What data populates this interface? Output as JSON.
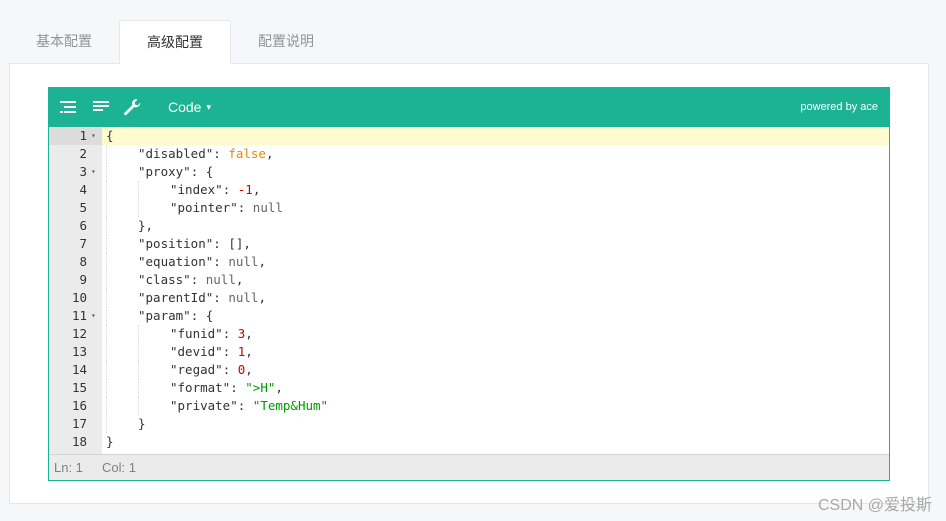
{
  "tabs": [
    {
      "label": "基本配置",
      "active": false
    },
    {
      "label": "高级配置",
      "active": true
    },
    {
      "label": "配置说明",
      "active": false
    }
  ],
  "editor": {
    "menu": {
      "icons": [
        "format-icon",
        "compact-icon",
        "repair-icon"
      ],
      "mode_label": "Code",
      "mode_caret": "▾",
      "powered_label": "powered by ace",
      "background_color": "#1bb394"
    },
    "lines": [
      {
        "n": "1",
        "fold": "▾",
        "indent": 0,
        "tokens": [
          {
            "t": "{",
            "c": "k"
          }
        ]
      },
      {
        "n": "2",
        "fold": "",
        "indent": 1,
        "tokens": [
          {
            "t": "\"disabled\"",
            "c": "k"
          },
          {
            "t": ": ",
            "c": "k"
          },
          {
            "t": "false",
            "c": "b"
          },
          {
            "t": ",",
            "c": "k"
          }
        ]
      },
      {
        "n": "3",
        "fold": "▾",
        "indent": 1,
        "tokens": [
          {
            "t": "\"proxy\"",
            "c": "k"
          },
          {
            "t": ": {",
            "c": "k"
          }
        ]
      },
      {
        "n": "4",
        "fold": "",
        "indent": 2,
        "tokens": [
          {
            "t": "\"index\"",
            "c": "k"
          },
          {
            "t": ": ",
            "c": "k"
          },
          {
            "t": "-1",
            "c": "n"
          },
          {
            "t": ",",
            "c": "k"
          }
        ]
      },
      {
        "n": "5",
        "fold": "",
        "indent": 2,
        "tokens": [
          {
            "t": "\"pointer\"",
            "c": "k"
          },
          {
            "t": ": ",
            "c": "k"
          },
          {
            "t": "null",
            "c": "nl"
          }
        ]
      },
      {
        "n": "6",
        "fold": "",
        "indent": 1,
        "tokens": [
          {
            "t": "},",
            "c": "k"
          }
        ]
      },
      {
        "n": "7",
        "fold": "",
        "indent": 1,
        "tokens": [
          {
            "t": "\"position\"",
            "c": "k"
          },
          {
            "t": ": [],",
            "c": "k"
          }
        ]
      },
      {
        "n": "8",
        "fold": "",
        "indent": 1,
        "tokens": [
          {
            "t": "\"equation\"",
            "c": "k"
          },
          {
            "t": ": ",
            "c": "k"
          },
          {
            "t": "null",
            "c": "nl"
          },
          {
            "t": ",",
            "c": "k"
          }
        ]
      },
      {
        "n": "9",
        "fold": "",
        "indent": 1,
        "tokens": [
          {
            "t": "\"class\"",
            "c": "k"
          },
          {
            "t": ": ",
            "c": "k"
          },
          {
            "t": "null",
            "c": "nl"
          },
          {
            "t": ",",
            "c": "k"
          }
        ]
      },
      {
        "n": "10",
        "fold": "",
        "indent": 1,
        "tokens": [
          {
            "t": "\"parentId\"",
            "c": "k"
          },
          {
            "t": ": ",
            "c": "k"
          },
          {
            "t": "null",
            "c": "nl"
          },
          {
            "t": ",",
            "c": "k"
          }
        ]
      },
      {
        "n": "11",
        "fold": "▾",
        "indent": 1,
        "tokens": [
          {
            "t": "\"param\"",
            "c": "k"
          },
          {
            "t": ": {",
            "c": "k"
          }
        ]
      },
      {
        "n": "12",
        "fold": "",
        "indent": 2,
        "tokens": [
          {
            "t": "\"funid\"",
            "c": "k"
          },
          {
            "t": ": ",
            "c": "k"
          },
          {
            "t": "3",
            "c": "n"
          },
          {
            "t": ",",
            "c": "k"
          }
        ]
      },
      {
        "n": "13",
        "fold": "",
        "indent": 2,
        "tokens": [
          {
            "t": "\"devid\"",
            "c": "k"
          },
          {
            "t": ": ",
            "c": "k"
          },
          {
            "t": "1",
            "c": "n"
          },
          {
            "t": ",",
            "c": "k"
          }
        ]
      },
      {
        "n": "14",
        "fold": "",
        "indent": 2,
        "tokens": [
          {
            "t": "\"regad\"",
            "c": "k"
          },
          {
            "t": ": ",
            "c": "k"
          },
          {
            "t": "0",
            "c": "n"
          },
          {
            "t": ",",
            "c": "k"
          }
        ]
      },
      {
        "n": "15",
        "fold": "",
        "indent": 2,
        "tokens": [
          {
            "t": "\"format\"",
            "c": "k"
          },
          {
            "t": ": ",
            "c": "k"
          },
          {
            "t": "\">H\"",
            "c": "s"
          },
          {
            "t": ",",
            "c": "k"
          }
        ]
      },
      {
        "n": "16",
        "fold": "",
        "indent": 2,
        "tokens": [
          {
            "t": "\"private\"",
            "c": "k"
          },
          {
            "t": ": ",
            "c": "k"
          },
          {
            "t": "\"Temp&Hum\"",
            "c": "s"
          }
        ]
      },
      {
        "n": "17",
        "fold": "",
        "indent": 1,
        "tokens": [
          {
            "t": "}",
            "c": "k"
          }
        ]
      },
      {
        "n": "18",
        "fold": "",
        "indent": 0,
        "tokens": [
          {
            "t": "}",
            "c": "k"
          }
        ]
      }
    ],
    "active_line": "1",
    "status": {
      "ln": "Ln: 1",
      "col": "Col: 1"
    }
  },
  "watermark": "CSDN @爱投斯"
}
